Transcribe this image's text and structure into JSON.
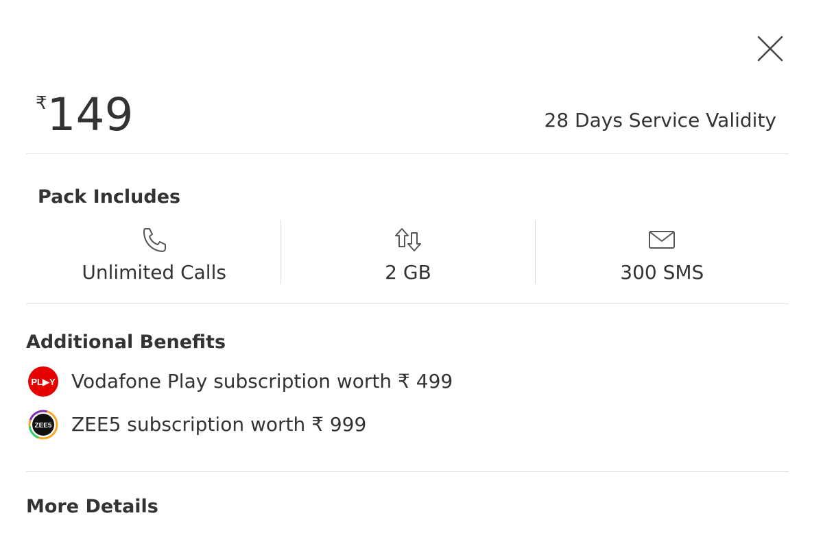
{
  "plan": {
    "currency_symbol": "₹",
    "price": "149",
    "validity": "28 Days Service Validity"
  },
  "pack": {
    "title": "Pack Includes",
    "items": [
      {
        "icon": "phone-icon",
        "label": "Unlimited Calls"
      },
      {
        "icon": "data-transfer-icon",
        "label": "2 GB"
      },
      {
        "icon": "envelope-icon",
        "label": "300 SMS"
      }
    ]
  },
  "benefits": {
    "title": "Additional Benefits",
    "items": [
      {
        "icon": "vodafone-play-logo",
        "logo_text": "PL▶Y",
        "text": "Vodafone Play subscription worth ₹ 499",
        "color": "#e60000"
      },
      {
        "icon": "zee5-logo",
        "logo_text": "ZEE5",
        "text": "ZEE5 subscription worth ₹ 999",
        "color": "#1a1a1a"
      }
    ]
  },
  "more": {
    "title": "More Details"
  },
  "colors": {
    "text": "#333333",
    "divider": "#e2e2e2",
    "vodafone_red": "#e60000"
  }
}
